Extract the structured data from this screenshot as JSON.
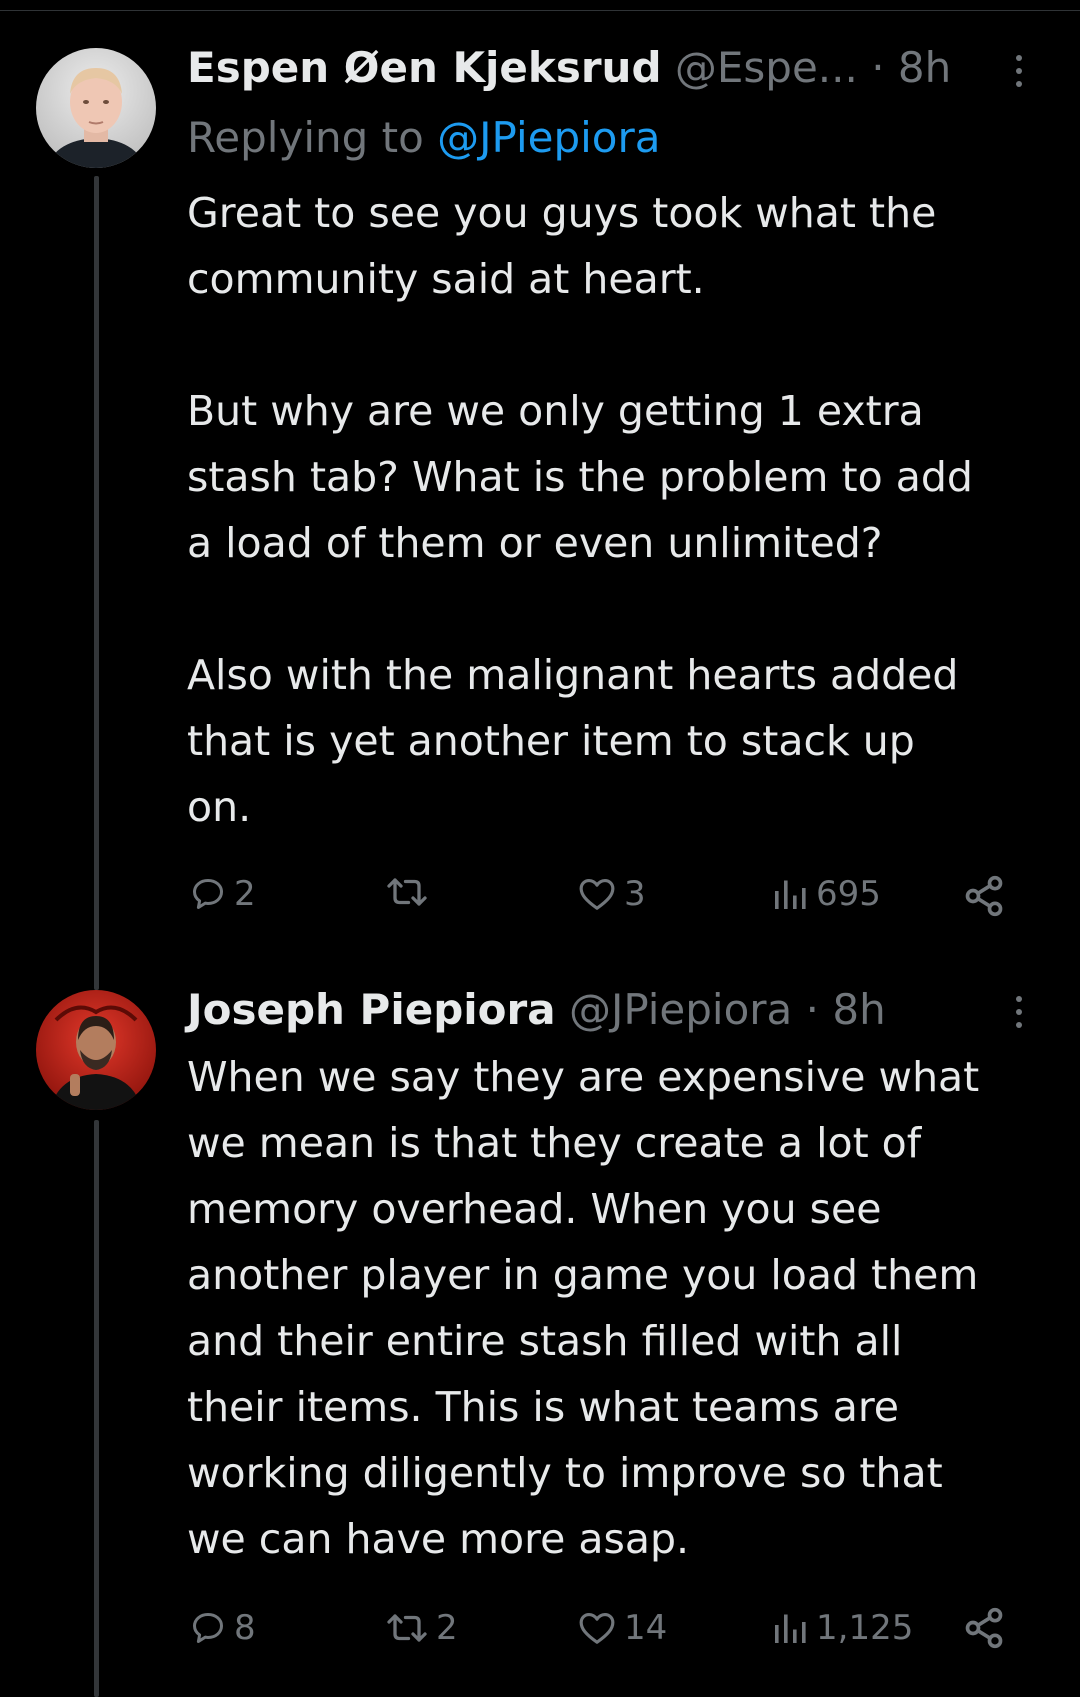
{
  "tweets": [
    {
      "display_name": "Espen Øen Kjeksrud",
      "handle": "@Espe...",
      "time": "· 8h",
      "replying_prefix": "Replying to",
      "replying_to": "@JPiepiora",
      "text_lines": [
        "Great to see you guys took what the",
        "community said at heart.",
        "",
        "But why are we only getting 1 extra",
        "stash tab? What is the problem to add",
        "a load of them or even unlimited?",
        "",
        "Also with the malignant hearts added",
        "that is yet another item to stack up",
        "on."
      ],
      "actions": {
        "replies": "2",
        "retweets": "",
        "likes": "3",
        "views": "695"
      }
    },
    {
      "display_name": "Joseph Piepiora",
      "handle": "@JPiepiora",
      "time": "· 8h",
      "text_lines": [
        "When we say they are expensive what",
        "we mean is that they create a lot of",
        "memory overhead. When you see",
        "another player in game you load them",
        "and their entire stash filled with all",
        "their items. This is what teams are",
        "working diligently to improve so that",
        "we can have more asap."
      ],
      "actions": {
        "replies": "8",
        "retweets": "2",
        "likes": "14",
        "views": "1,125"
      }
    }
  ],
  "icons": {
    "reply": "reply-icon",
    "retweet": "retweet-icon",
    "like": "heart-icon",
    "views": "views-chart-icon",
    "share": "share-icon",
    "more": "more-vertical-icon"
  },
  "colors": {
    "background": "#000000",
    "text": "#e7e9ea",
    "secondary": "#71767b",
    "link": "#1d9bf0",
    "thread_line": "#333639"
  }
}
